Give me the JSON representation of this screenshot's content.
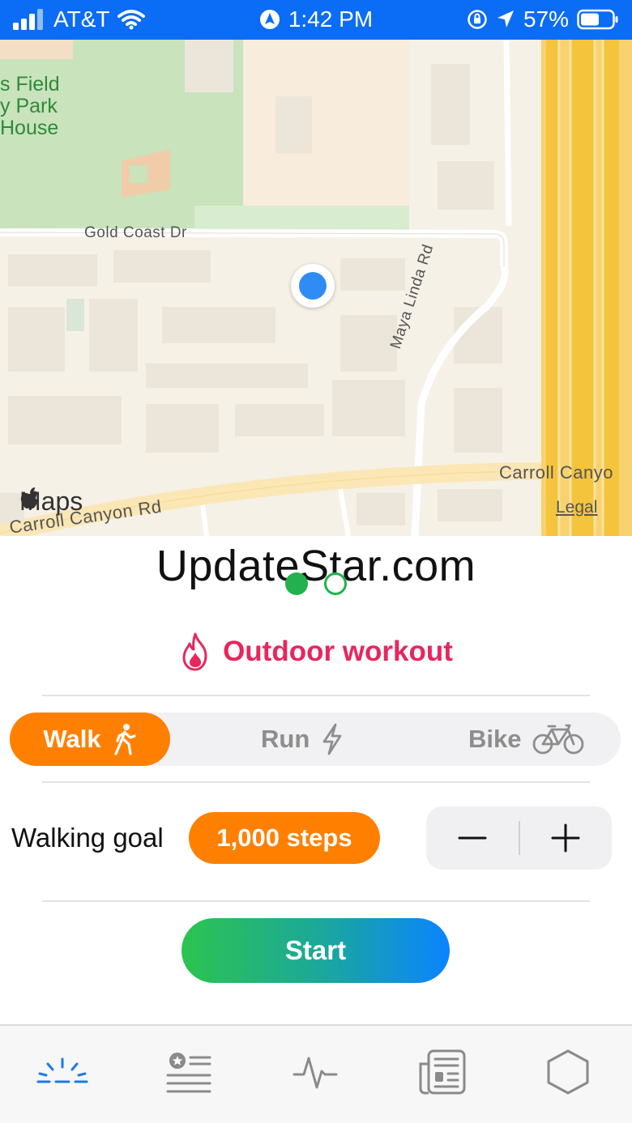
{
  "status_bar": {
    "carrier": "AT&T",
    "time": "1:42 PM",
    "battery": "57%"
  },
  "map": {
    "park_label": "s Field\ny Park\nHouse",
    "street_gold_coast": "Gold Coast Dr",
    "street_maya_linda": "Maya Linda Rd",
    "street_carroll_canyon": "Carroll Canyon Rd",
    "street_carroll_canyon_right": "Carroll Canyo",
    "maps_brand": "Maps",
    "legal": "Legal"
  },
  "watermark": "UpdateStar.com",
  "pager": {
    "current": 1,
    "total": 2
  },
  "workout": {
    "title": "Outdoor workout",
    "modes": [
      {
        "label": "Walk",
        "icon": "walk-icon",
        "selected": true
      },
      {
        "label": "Run",
        "icon": "lightning-icon",
        "selected": false
      },
      {
        "label": "Bike",
        "icon": "bike-icon",
        "selected": false
      }
    ],
    "goal_label": "Walking goal",
    "goal_value": "1,000 steps",
    "start_label": "Start"
  },
  "tabs": [
    {
      "icon": "sunrise-icon",
      "selected": true
    },
    {
      "icon": "favorites-list-icon",
      "selected": false
    },
    {
      "icon": "heartbeat-icon",
      "selected": false
    },
    {
      "icon": "news-icon",
      "selected": false
    },
    {
      "icon": "hexagon-icon",
      "selected": false
    }
  ],
  "colors": {
    "status_bar": "#0b6cf5",
    "accent_orange": "#ff8000",
    "title_pink": "#e8265e",
    "pager_green": "#22b14c",
    "start_gradient_start": "#2cc44f",
    "start_gradient_end": "#0a84ff",
    "tab_selected": "#1e7ae8"
  }
}
